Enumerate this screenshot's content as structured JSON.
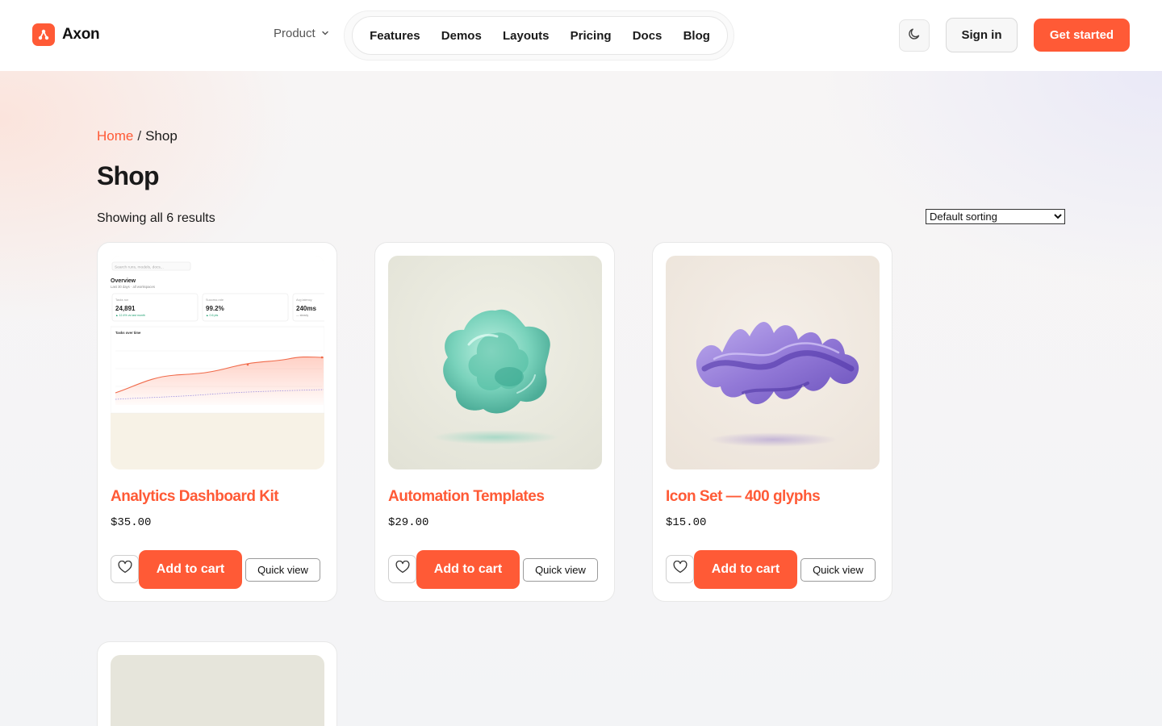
{
  "brand": {
    "name": "Axon",
    "accent": "#ff5a36"
  },
  "nav": {
    "product_label": "Product",
    "links": [
      "Features",
      "Demos",
      "Layouts",
      "Pricing",
      "Docs",
      "Blog"
    ],
    "sign_in": "Sign in",
    "get_started": "Get started"
  },
  "breadcrumb": {
    "home": "Home",
    "separator": "/",
    "current": "Shop"
  },
  "page": {
    "title": "Shop",
    "result_count": "Showing all 6 results",
    "sort_selected": "Default sorting"
  },
  "dashboard_preview": {
    "search_placeholder": "Search runs, models, docs...",
    "heading": "Overview",
    "subheading": "Last 30 days · all workspaces",
    "stats": [
      {
        "label": "Tasks run",
        "value": "24,891",
        "delta": "▲ 12.4% vs last month"
      },
      {
        "label": "Success rate",
        "value": "99.2%",
        "delta": "▲ 0.6 pts"
      },
      {
        "label": "Avg latency",
        "value": "240ms",
        "delta": "— steady"
      }
    ],
    "chart_label": "Tasks over time"
  },
  "products": [
    {
      "title": "Analytics Dashboard Kit",
      "price": "$35.00",
      "add_to_cart": "Add to cart",
      "quick_view": "Quick view",
      "image": "dashboard-screenshot"
    },
    {
      "title": "Automation Templates",
      "price": "$29.00",
      "add_to_cart": "Add to cart",
      "quick_view": "Quick view",
      "image": "teal-glass-blob"
    },
    {
      "title": "Icon Set — 400 glyphs",
      "price": "$15.00",
      "add_to_cart": "Add to cart",
      "quick_view": "Quick view",
      "image": "purple-glass-wave"
    },
    {
      "image": "beige-placeholder"
    }
  ],
  "icons": [
    "axon-logo-icon",
    "chevron-down-icon",
    "moon-icon",
    "heart-icon"
  ]
}
